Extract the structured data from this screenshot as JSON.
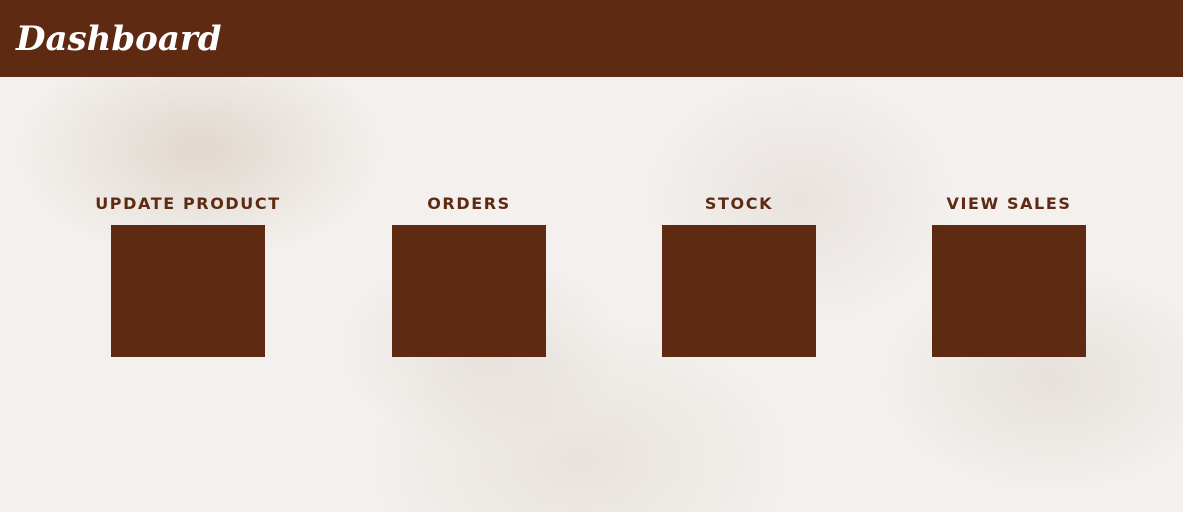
{
  "header": {
    "title": "Dashboard"
  },
  "tiles": [
    {
      "label": "UPDATE PRODUCT"
    },
    {
      "label": "ORDERS"
    },
    {
      "label": "STOCK"
    },
    {
      "label": "VIEW SALES"
    }
  ],
  "colors": {
    "brand": "#5f2a12",
    "background": "#f3f0ed",
    "header_text": "#ffffff"
  }
}
